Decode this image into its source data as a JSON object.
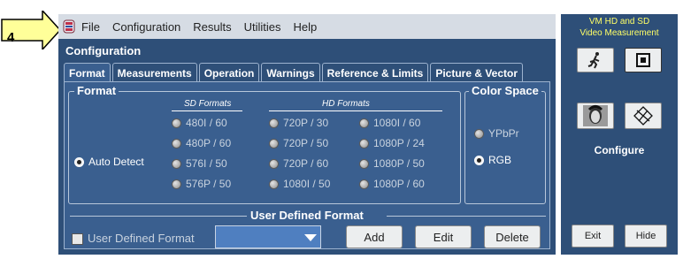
{
  "callout": {
    "number": "4"
  },
  "menu": {
    "items": [
      "File",
      "Configuration",
      "Results",
      "Utilities",
      "Help"
    ]
  },
  "header": {
    "section_title": "Configuration"
  },
  "tabs": [
    "Format",
    "Measurements",
    "Operation",
    "Warnings",
    "Reference & Limits",
    "Picture & Vector"
  ],
  "format_group": {
    "title": "Format",
    "auto_detect": "Auto Detect",
    "sd_heading": "SD Formats",
    "hd_heading": "HD Formats",
    "sd_formats": [
      "480I / 60",
      "480P / 60",
      "576I / 50",
      "576P / 50"
    ],
    "hd_col1": [
      "720P / 30",
      "720P / 50",
      "720P / 60",
      "1080I / 50"
    ],
    "hd_col2": [
      "1080I / 60",
      "1080P / 24",
      "1080P / 50",
      "1080P / 60"
    ]
  },
  "color_space": {
    "title": "Color Space",
    "options": [
      "YPbPr",
      "RGB"
    ],
    "selected": "RGB"
  },
  "user_defined": {
    "title": "User Defined Format",
    "checkbox_label": "User Defined Format",
    "add": "Add",
    "edit": "Edit",
    "delete": "Delete"
  },
  "side_panel": {
    "title_line1": "VM HD and SD",
    "title_line2": "Video Measurement",
    "configure_label": "Configure",
    "exit": "Exit",
    "hide": "Hide"
  },
  "colors": {
    "panel_bg": "#3a5f8f",
    "window_bg": "#2e4f78",
    "title_accent": "#ffff66",
    "dropdown": "#4f7fc0"
  }
}
